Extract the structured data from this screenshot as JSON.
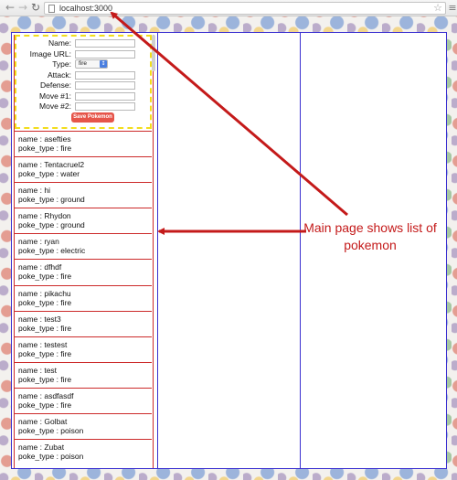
{
  "browser": {
    "url": "localhost:3000",
    "back_icon": "back-arrow-icon",
    "forward_icon": "forward-arrow-icon",
    "reload_icon": "reload-icon"
  },
  "form": {
    "name_label": "Name:",
    "image_url_label": "Image URL:",
    "type_label": "Type:",
    "type_value": "fire",
    "attack_label": "Attack:",
    "defense_label": "Defense:",
    "move1_label": "Move #1:",
    "move2_label": "Move #2:",
    "save_label": "Save Pokemon"
  },
  "pokemon": [
    {
      "name": "name : asefties",
      "type": "poke_type : fire"
    },
    {
      "name": "name : Tentacruel2",
      "type": "poke_type : water"
    },
    {
      "name": "name : hi",
      "type": "poke_type : ground"
    },
    {
      "name": "name : Rhydon",
      "type": "poke_type : ground"
    },
    {
      "name": "name : ryan",
      "type": "poke_type : electric"
    },
    {
      "name": "name : dfhdf",
      "type": "poke_type : fire"
    },
    {
      "name": "name : pikachu",
      "type": "poke_type : fire"
    },
    {
      "name": "name : test3",
      "type": "poke_type : fire"
    },
    {
      "name": "name : testest",
      "type": "poke_type : fire"
    },
    {
      "name": "name : test",
      "type": "poke_type : fire"
    },
    {
      "name": "name : asdfasdf",
      "type": "poke_type : fire"
    },
    {
      "name": "name : Golbat",
      "type": "poke_type : poison"
    },
    {
      "name": "name : Zubat",
      "type": "poke_type : poison"
    }
  ],
  "annotation": {
    "text": "Main page shows list of pokemon",
    "color": "#c41a1a"
  }
}
